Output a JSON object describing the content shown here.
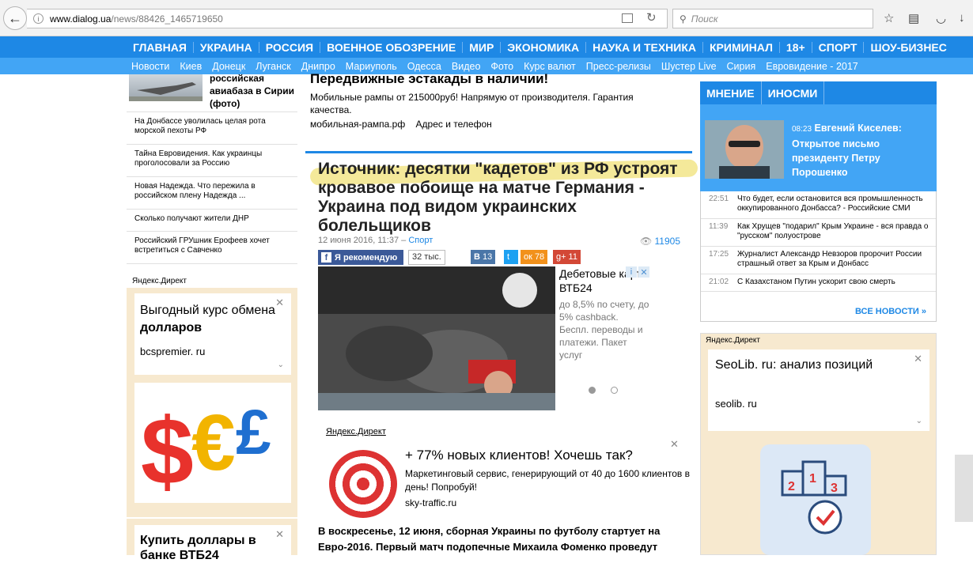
{
  "browser": {
    "url_domain": "www.dialog.ua",
    "url_path": "/news/88426_1465719650",
    "search_placeholder": "Поиск"
  },
  "topnav": [
    "ГЛАВНАЯ",
    "УКРАИНА",
    "РОССИЯ",
    "ВОЕННОЕ ОБОЗРЕНИЕ",
    "МИР",
    "ЭКОНОМИКА",
    "НАУКА И ТЕХНИКА",
    "КРИМИНАЛ",
    "18+",
    "СПОРТ",
    "ШОУ-БИЗНЕС"
  ],
  "subnav": [
    "Новости",
    "Киев",
    "Донецк",
    "Луганск",
    "Днипро",
    "Мариуполь",
    "Одесса",
    "Видео",
    "Фото",
    "Курс валют",
    "Пресс-релизы",
    "Шустер Live",
    "Сирия",
    "Евровидение - 2017"
  ],
  "left": {
    "lead_title": "российская авиабаза в Сирии (фото)",
    "news": [
      "На Донбассе уволилась целая рота морской пехоты РФ",
      "Тайна Евровидения. Как украинцы проголосовали за Россию",
      "Новая Надежда. Что пережила в российском плену Надежда ...",
      "Сколько получают жители ДНР",
      "Российский ГРУшник Ерофеев хочет встретиться с Савченко"
    ],
    "yandex_label": "Яндекс.Директ",
    "ad1_head_pre": "Выгодный курс обмена ",
    "ad1_head_bold": "долларов",
    "ad1_host": "bcspremier. ru",
    "ad2_head": "Купить доллары в банке ВТБ24"
  },
  "top_ad": {
    "title": "Передвижные эстакады в наличии!",
    "desc": "Мобильные рампы от 215000руб! Напрямую от производителя. Гарантия качества.",
    "site": "мобильная-рампа.рф",
    "contact": "Адрес и телефон"
  },
  "article": {
    "title": "Источник: десятки \"кадетов\" из РФ устроят кровавое побоище на матче Германия - Украина под видом украинских болельщиков",
    "date": "12 июня 2016, 11:37 –",
    "category": "Спорт",
    "views": "11905",
    "fb_label": "Я рекомендую",
    "fb_count": "32 тыс.",
    "vk_count": "13",
    "ok_count": "78",
    "gp_count": "11",
    "lead": "В воскресенье, 12 июня, сборная Украины по футболу стартует на Евро-2016. Первый матч подопечные Михаила Фоменко проведут"
  },
  "photo_ad": {
    "head": "Дебетовые карты ВТБ24",
    "body": "до 8,5% по счету, до 5% cashback. Беспл. переводы и платежи. Пакет услуг"
  },
  "sky_ad": {
    "label": "Яндекс.Директ",
    "head": "+ 77% новых клиентов! Хочешь так?",
    "body": "Маркетинговый сервис, генерирующий от 40 до 1600 клиентов в день! Попробуй!",
    "host": "sky-traffic.ru"
  },
  "right": {
    "tabs": [
      "МНЕНИЕ",
      "ИНОСМИ"
    ],
    "opinion_time": "08:23",
    "opinion_title": "Евгений Киселев: Открытое письмо президенту Петру Порошенко",
    "news": [
      {
        "time": "22:51",
        "text": "Что будет, если остановится вся промышленность оккупированного Донбасса? - Российские СМИ"
      },
      {
        "time": "11:39",
        "text": "Как Хрущев \"подарил\" Крым Украине - вся правда о \"русском\" полуострове"
      },
      {
        "time": "17:25",
        "text": "Журналист Александр Невзоров пророчит России страшный ответ за Крым и Донбасс"
      },
      {
        "time": "21:02",
        "text": "С Казахстаном Путин ускорит свою смерть"
      }
    ],
    "all_news": "ВСЕ НОВОСТИ »",
    "ad_label": "Яндекс.Директ",
    "ad_head": "SeoLib. ru: анализ позиций",
    "ad_host": "seolib. ru"
  }
}
